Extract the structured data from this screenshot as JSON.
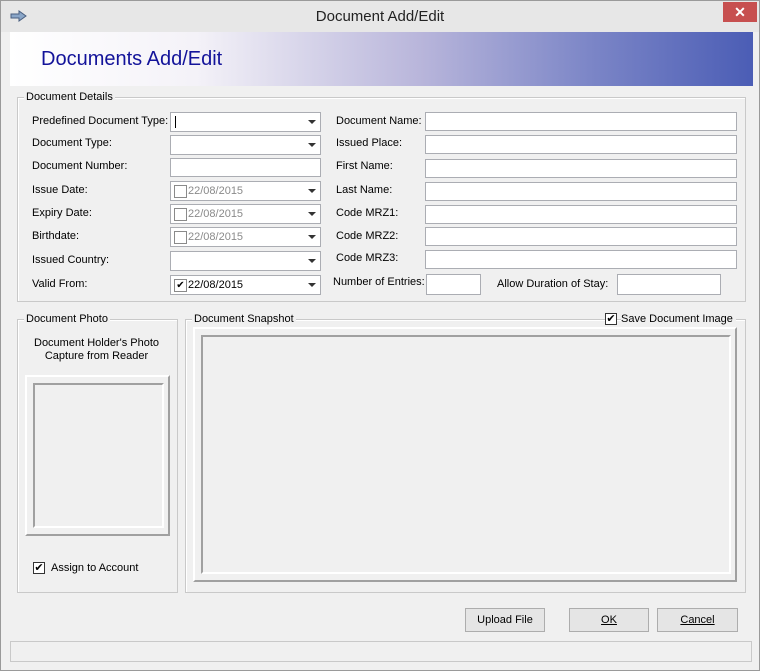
{
  "window": {
    "title": "Document Add/Edit",
    "close_glyph": "✕"
  },
  "header": {
    "title": "Documents Add/Edit",
    "gradient_colors": [
      "#ffffff",
      "#4b5db5"
    ],
    "title_color": "#13139a"
  },
  "details": {
    "group_label": "Document Details",
    "predefined_type": {
      "label": "Predefined Document Type:",
      "value": ""
    },
    "doc_type": {
      "label": "Document Type:",
      "value": ""
    },
    "doc_number": {
      "label": "Document Number:",
      "value": ""
    },
    "issue_date": {
      "label": "Issue Date:",
      "value": "22/08/2015",
      "checked": false
    },
    "expiry_date": {
      "label": "Expiry Date:",
      "value": "22/08/2015",
      "checked": false
    },
    "birthdate": {
      "label": "Birthdate:",
      "value": "22/08/2015",
      "checked": false
    },
    "issued_country": {
      "label": "Issued Country:",
      "value": ""
    },
    "valid_from": {
      "label": "Valid From:",
      "value": "22/08/2015",
      "checked": true
    },
    "doc_name": {
      "label": "Document Name:",
      "value": ""
    },
    "issued_place": {
      "label": "Issued Place:",
      "value": ""
    },
    "first_name": {
      "label": "First Name:",
      "value": ""
    },
    "last_name": {
      "label": "Last Name:",
      "value": ""
    },
    "mrz1": {
      "label": "Code MRZ1:",
      "value": ""
    },
    "mrz2": {
      "label": "Code MRZ2:",
      "value": ""
    },
    "mrz3": {
      "label": "Code MRZ3:",
      "value": ""
    },
    "entries": {
      "label": "Number of Entries:",
      "value": ""
    },
    "duration": {
      "label": "Allow Duration of Stay:",
      "value": ""
    }
  },
  "photo": {
    "group_label": "Document Photo",
    "caption_line1": "Document Holder's Photo",
    "caption_line2": "Capture from Reader",
    "assign_label": "Assign to Account",
    "assign_checked": true
  },
  "snapshot": {
    "group_label": "Document Snapshot",
    "save_label": "Save Document Image",
    "save_checked": true
  },
  "buttons": {
    "upload": "Upload File",
    "ok": "OK",
    "cancel": "Cancel"
  },
  "icons": {
    "app": "arrow-app-icon",
    "dropdown": "chevron-down-icon",
    "check": "✔"
  }
}
